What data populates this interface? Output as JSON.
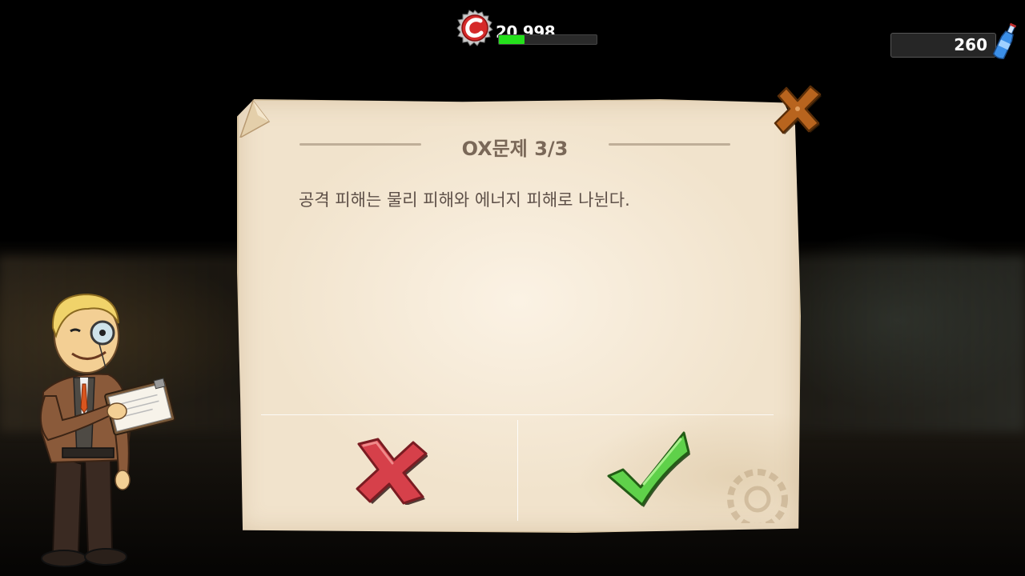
{
  "hud": {
    "caps": {
      "value": "20,998",
      "progress": 0.26,
      "icon": "bottle-cap-icon"
    },
    "quantum": {
      "value": "260",
      "icon": "nuka-cola-quantum-icon"
    }
  },
  "dialog": {
    "title": "OX문제 3/3",
    "question": "공격 피해는 물리 피해와 에너지 피해로 나뉜다.",
    "close_icon": "close-icon",
    "answers": [
      {
        "name": "false-answer",
        "icon": "x-mark-icon"
      },
      {
        "name": "true-answer",
        "icon": "check-mark-icon"
      }
    ]
  },
  "colors": {
    "paper": "#f6ead6",
    "title_text": "#7a6858",
    "body_text": "#5e5048",
    "x_mark": "#d6404a",
    "check_mark": "#5fd14a",
    "caps_bar": "#25e01c",
    "close_x": "#b8641e"
  }
}
